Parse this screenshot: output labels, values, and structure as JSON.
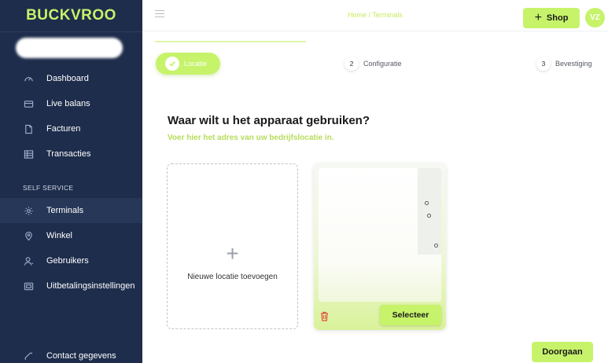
{
  "brand": {
    "logo_text": "BUCKVROO",
    "accent": "#c6f36a",
    "sidebar_bg": "#1e2d4c"
  },
  "sidebar": {
    "main_items": [
      {
        "label": "Dashboard",
        "icon": "gauge-icon"
      },
      {
        "label": "Live balans",
        "icon": "wallet-icon"
      },
      {
        "label": "Facturen",
        "icon": "document-icon"
      },
      {
        "label": "Transacties",
        "icon": "list-icon"
      }
    ],
    "section_label": "SELF SERVICE",
    "self_service_items": [
      {
        "label": "Terminals",
        "icon": "gear-icon",
        "active": true
      },
      {
        "label": "Winkel",
        "icon": "location-pin-icon"
      },
      {
        "label": "Gebruikers",
        "icon": "user-icon"
      },
      {
        "label": "Uitbetalingsinstellingen",
        "icon": "payout-icon"
      }
    ],
    "footer_item": {
      "label": "Contact gegevens",
      "icon": "phone-icon"
    }
  },
  "topbar": {
    "breadcrumb": "Home / Terminals",
    "shop_label": "Shop",
    "avatar_initials": "VZ"
  },
  "stepper": {
    "steps": [
      {
        "number": "1",
        "label": "Locatie",
        "state": "done"
      },
      {
        "number": "2",
        "label": "Configuratie",
        "state": "pending"
      },
      {
        "number": "3",
        "label": "Bevestiging",
        "state": "pending"
      }
    ]
  },
  "main": {
    "heading": "Waar wilt u het apparaat gebruiken?",
    "subheading": "Voer hier het adres van uw bedrijfslocatie in.",
    "add_location_label": "Nieuwe locatie toevoegen",
    "select_label": "Selecteer",
    "next_label": "Doorgaan"
  }
}
